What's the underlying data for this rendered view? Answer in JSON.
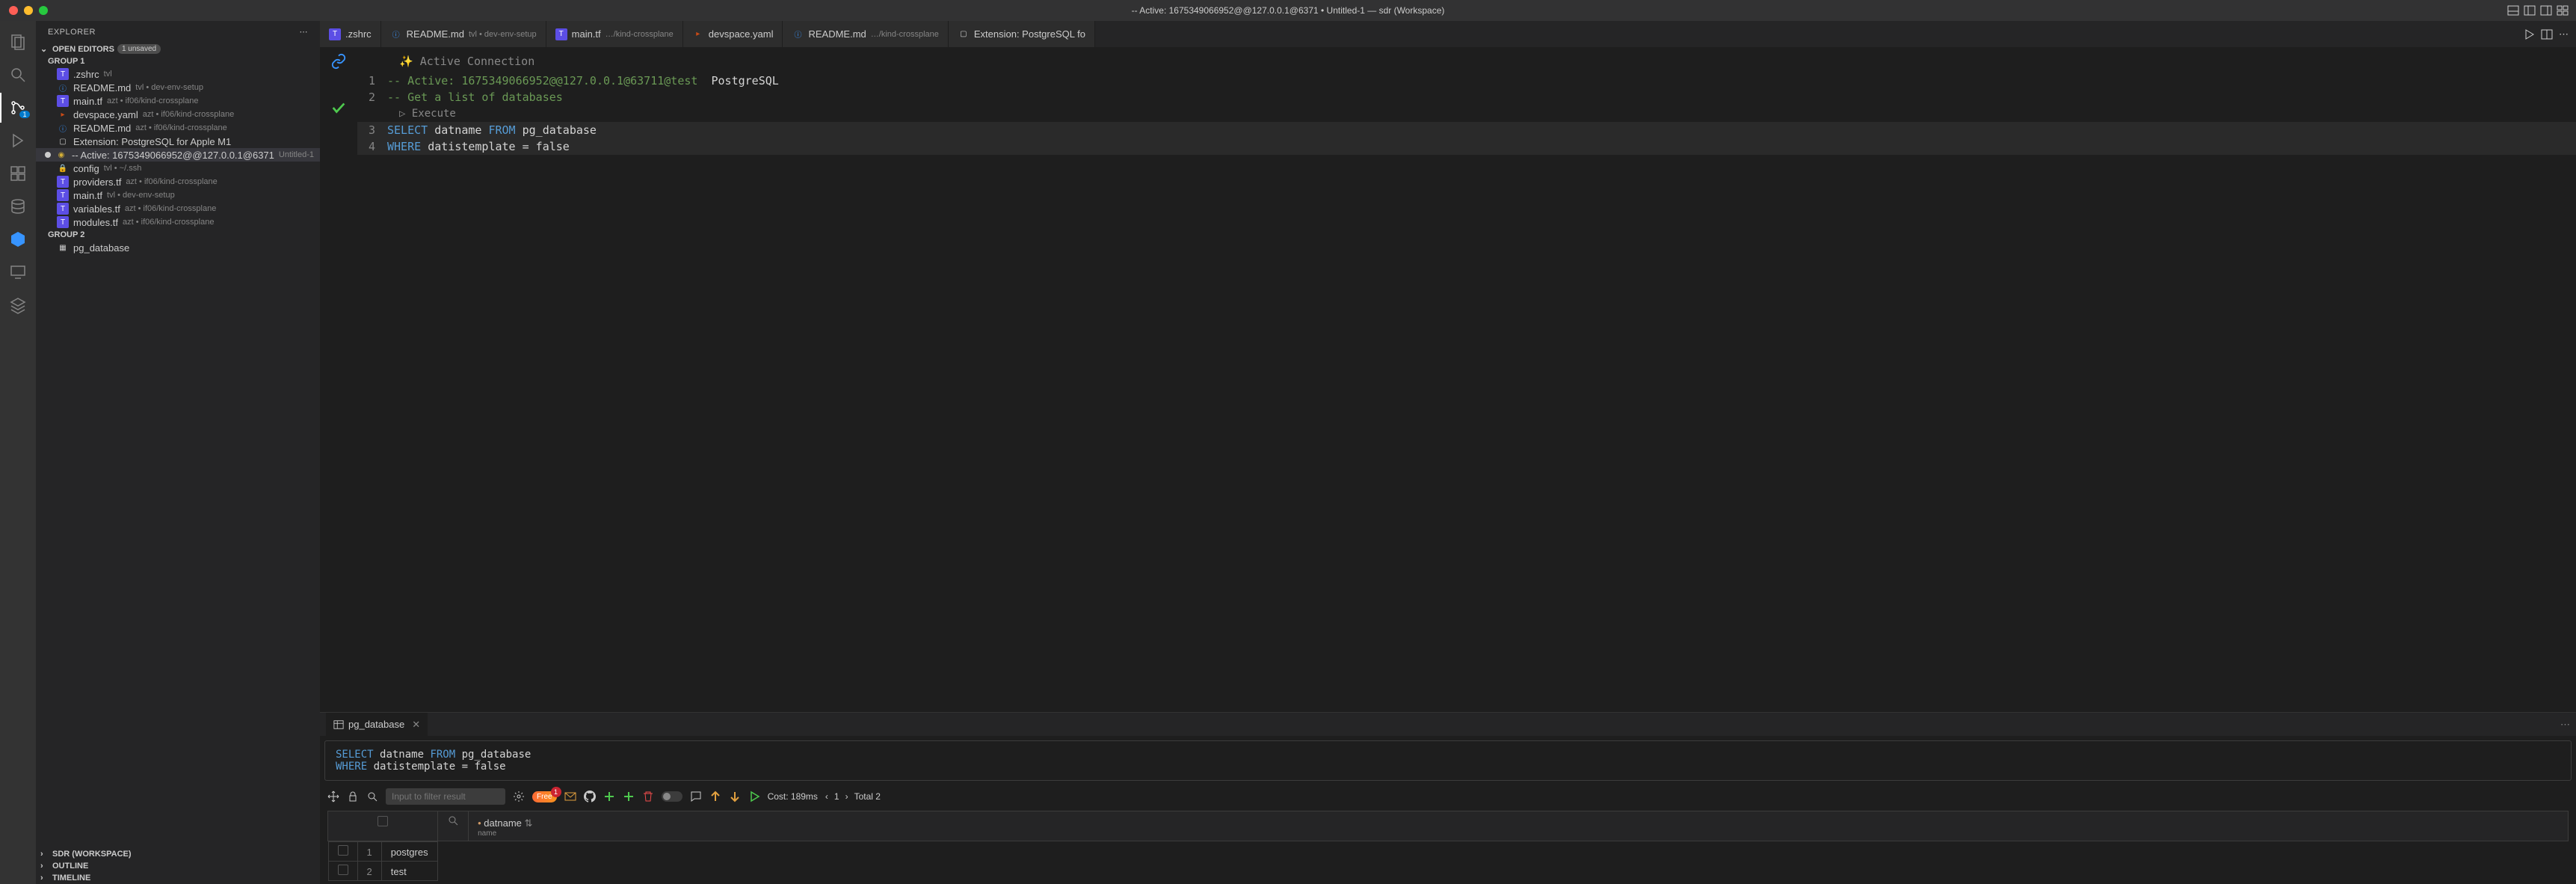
{
  "titlebar": {
    "title": "-- Active: 1675349066952@@127.0.0.1@6371 • Untitled-1 — sdr (Workspace)"
  },
  "activitybar": {
    "scm_badge": "1"
  },
  "sidebar": {
    "title": "EXPLORER",
    "open_editors": {
      "label": "OPEN EDITORS",
      "unsaved": "1 unsaved"
    },
    "group1_label": "GROUP 1",
    "group2_label": "GROUP 2",
    "group1": [
      {
        "icon": "terraform",
        "name": ".zshrc",
        "desc": "tvl"
      },
      {
        "icon": "info",
        "name": "README.md",
        "desc": "tvl • dev-env-setup"
      },
      {
        "icon": "terraform",
        "name": "main.tf",
        "desc": "azt • if06/kind-crossplane"
      },
      {
        "icon": "yaml",
        "name": "devspace.yaml",
        "desc": "azt • if06/kind-crossplane"
      },
      {
        "icon": "info",
        "name": "README.md",
        "desc": "azt • if06/kind-crossplane"
      },
      {
        "icon": "ext",
        "name": "Extension: PostgreSQL for Apple M1",
        "desc": ""
      },
      {
        "icon": "db",
        "name": "-- Active: 1675349066952@@127.0.0.1@6371",
        "desc": "Untitled-1",
        "modified": true,
        "active": true
      },
      {
        "icon": "lock",
        "name": "config",
        "desc": "tvl • ~/.ssh"
      },
      {
        "icon": "terraform",
        "name": "providers.tf",
        "desc": "azt • if06/kind-crossplane"
      },
      {
        "icon": "terraform",
        "name": "main.tf",
        "desc": "tvl • dev-env-setup"
      },
      {
        "icon": "terraform",
        "name": "variables.tf",
        "desc": "azt • if06/kind-crossplane"
      },
      {
        "icon": "terraform",
        "name": "modules.tf",
        "desc": "azt • if06/kind-crossplane"
      }
    ],
    "group2": [
      {
        "icon": "table",
        "name": "pg_database",
        "desc": ""
      }
    ],
    "sections": {
      "workspace": "SDR (WORKSPACE)",
      "outline": "OUTLINE",
      "timeline": "TIMELINE"
    }
  },
  "tabs": [
    {
      "icon": "terraform",
      "name": ".zshrc",
      "desc": ""
    },
    {
      "icon": "info",
      "name": "README.md",
      "desc": "tvl • dev-env-setup"
    },
    {
      "icon": "terraform",
      "name": "main.tf",
      "desc": "…/kind-crossplane"
    },
    {
      "icon": "yaml",
      "name": "devspace.yaml",
      "desc": ""
    },
    {
      "icon": "info",
      "name": "README.md",
      "desc": "…/kind-crossplane"
    },
    {
      "icon": "ext",
      "name": "Extension: PostgreSQL fo",
      "desc": ""
    }
  ],
  "editor": {
    "banner": "✨ Active Connection",
    "execute": "▷ Execute",
    "lines": [
      {
        "n": "1",
        "html": "<span class='c-comment'>-- Active: 1675349066952@@127.0.0.1@63711@test</span>  <span class='c-ident'>PostgreSQL</span>"
      },
      {
        "n": "2",
        "html": "<span class='c-comment'>-- Get a list of databases</span>"
      },
      {
        "n": "3",
        "html": "<span class='c-kw'>SELECT</span> <span class='c-ident'>datname </span><span class='c-kw'>FROM</span> <span class='c-ident'>pg_database</span>"
      },
      {
        "n": "4",
        "html": "<span class='c-kw'>WHERE</span> <span class='c-ident'>datistemplate = false</span>"
      }
    ]
  },
  "panel": {
    "tab": "pg_database",
    "query_html": "<span class='c-kw'>SELECT</span> <span class='c-ident'>datname </span><span class='c-kw'>FROM</span> <span class='c-ident'>pg_database</span><br><span class='c-kw'>WHERE</span> <span class='c-ident'>datistemplate = false</span>",
    "filter_placeholder": "Input to filter result",
    "free": "Free",
    "free_count": "1",
    "cost": "Cost: 189ms",
    "page": "1",
    "total": "Total 2",
    "column": {
      "name": "datname",
      "type": "name"
    },
    "rows": [
      {
        "idx": "1",
        "val": "postgres"
      },
      {
        "idx": "2",
        "val": "test"
      }
    ]
  }
}
